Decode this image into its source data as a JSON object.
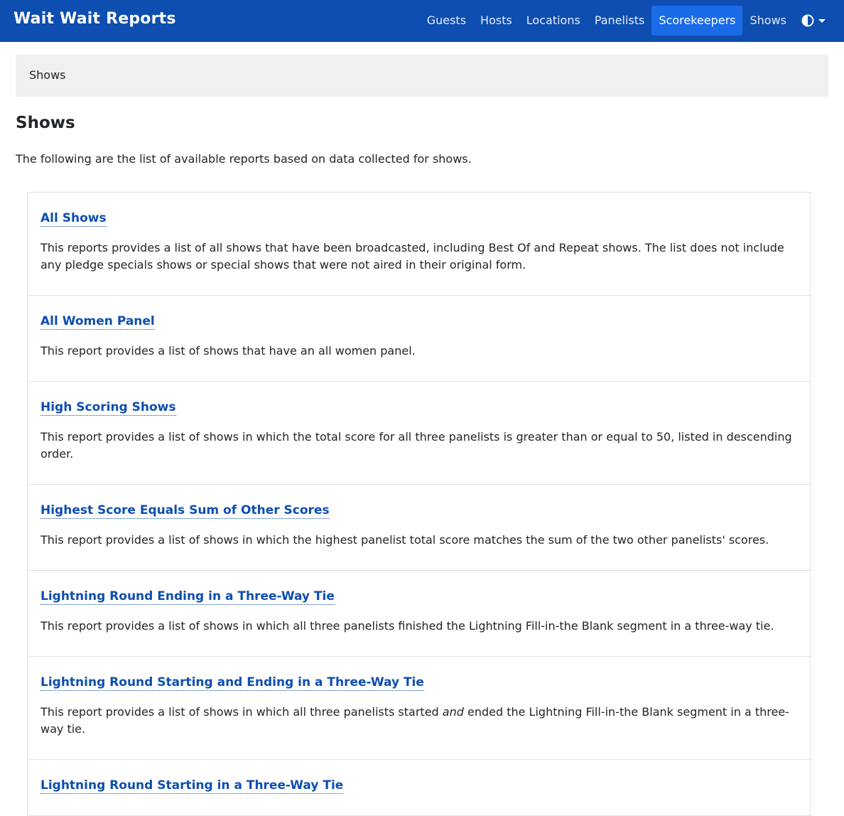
{
  "navbar": {
    "brand": "Wait Wait Reports",
    "links": [
      {
        "label": "Guests"
      },
      {
        "label": "Hosts"
      },
      {
        "label": "Locations"
      },
      {
        "label": "Panelists"
      },
      {
        "label": "Scorekeepers",
        "active": true
      },
      {
        "label": "Shows"
      }
    ],
    "theme_icon": "contrast-half-circle-icon"
  },
  "breadcrumb": {
    "current": "Shows"
  },
  "page": {
    "title": "Shows",
    "intro": "The following are the list of available reports based on data collected for shows."
  },
  "reports": [
    {
      "title": "All Shows",
      "description": "This reports provides a list of all shows that have been broadcasted, including Best Of and Repeat shows. The list does not include any pledge specials shows or special shows that were not aired in their original form."
    },
    {
      "title": "All Women Panel",
      "description": "This report provides a list of shows that have an all women panel."
    },
    {
      "title": "High Scoring Shows",
      "description": "This report provides a list of shows in which the total score for all three panelists is greater than or equal to 50, listed in descending order."
    },
    {
      "title": "Highest Score Equals Sum of Other Scores",
      "description": "This report provides a list of shows in which the highest panelist total score matches the sum of the two other panelists' scores."
    },
    {
      "title": "Lightning Round Ending in a Three-Way Tie",
      "description": "This report provides a list of shows in which all three panelists finished the Lightning Fill-in-the Blank segment in a three-way tie."
    },
    {
      "title": "Lightning Round Starting and Ending in a Three-Way Tie",
      "description_before": "This report provides a list of shows in which all three panelists started ",
      "description_emphasis": "and",
      "description_after": " ended the Lightning Fill-in-the Blank segment in a three-way tie."
    },
    {
      "title": "Lightning Round Starting in a Three-Way Tie"
    }
  ]
}
